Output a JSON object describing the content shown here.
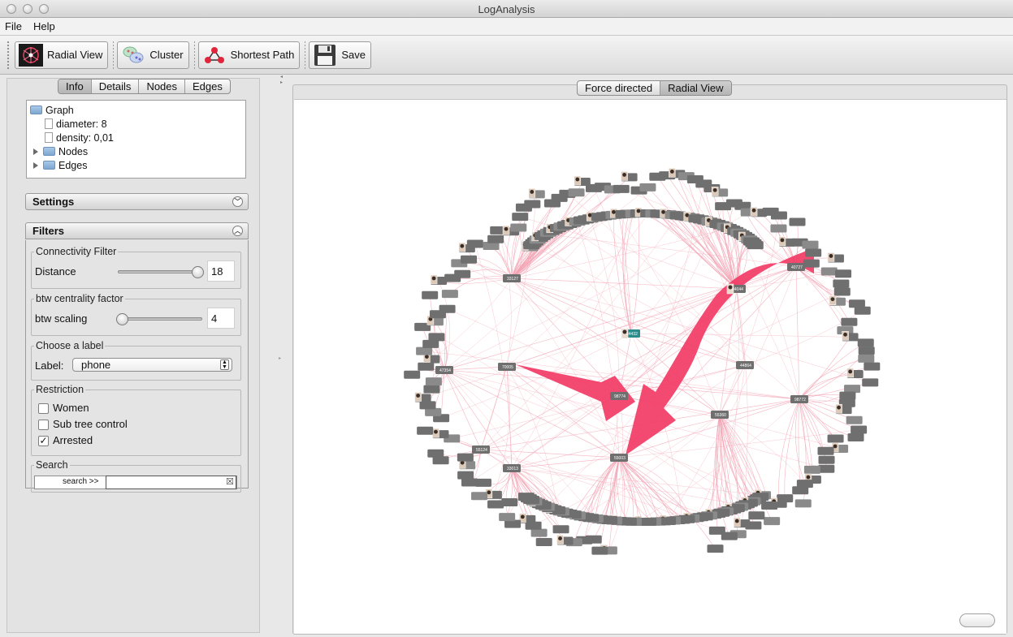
{
  "window": {
    "title": "LogAnalysis"
  },
  "menu": {
    "file": "File",
    "help": "Help"
  },
  "toolbar": {
    "radial_view": "Radial View",
    "cluster": "Cluster",
    "shortest_path": "Shortest Path",
    "save": "Save"
  },
  "left_tabs": [
    "Info",
    "Details",
    "Nodes",
    "Edges"
  ],
  "left_tabs_selected": "Info",
  "info_tree": {
    "root": "Graph",
    "diameter": "diameter: 8",
    "density": "density: 0,01",
    "nodes": "Nodes",
    "edges": "Edges"
  },
  "settings": {
    "title": "Settings"
  },
  "filters": {
    "title": "Filters",
    "connectivity": {
      "group": "Connectivity Filter",
      "label": "Distance",
      "value": "18",
      "level": 0.94
    },
    "btw": {
      "group": "btw centrality factor",
      "label": "btw scaling",
      "value": "4",
      "level": 0.05
    },
    "label_group": {
      "group": "Choose a label",
      "label": "Label:",
      "selected": "phone"
    },
    "restriction": {
      "group": "Restriction",
      "options": [
        {
          "label": "Women",
          "checked": false
        },
        {
          "label": "Sub tree control",
          "checked": false
        },
        {
          "label": "Arrested",
          "checked": true
        }
      ]
    },
    "search": {
      "group": "Search",
      "label": "search >>",
      "value": ""
    }
  },
  "view_tabs": [
    "Force directed",
    "Radial View"
  ],
  "view_tabs_selected": "Radial View",
  "graph": {
    "hub_labels": [
      "55003",
      "34432",
      "70005",
      "98774",
      "40727",
      "34044",
      "47354",
      "33127",
      "55124",
      "55360",
      "98772",
      "44864",
      "33013"
    ],
    "colors": {
      "edge": "#f3a3b3",
      "arrow": "#f23b66",
      "node": "#6f6f6f",
      "hub_highlight": "#2b8c8c"
    }
  }
}
